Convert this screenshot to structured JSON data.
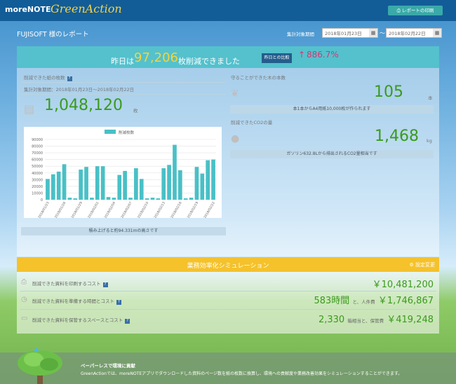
{
  "app": {
    "brand_main": "moreNOTE",
    "brand_sub": "GreenAction",
    "print_button": "レポートの印刷"
  },
  "report": {
    "title": "FUJISOFT 様のレポート",
    "period_label": "集計対象期間",
    "date_from": "2018年01月23日",
    "date_to": "2018年02月22日",
    "date_sep": "～"
  },
  "headline": {
    "prefix": "昨日は",
    "number": "97,206",
    "suffix": "枚削減できました",
    "compare_label": "昨日との比較",
    "arrow": "↑",
    "percent": "886.7%"
  },
  "left": {
    "label": "削減できた紙の枚数",
    "period": "集計対象期間：2018年01月23日～2018年02月22日",
    "total": "1,048,120",
    "unit": "枚",
    "note": "積み上げると約94.331mの高さです"
  },
  "trees": {
    "label": "守ることができた木の本数",
    "value": "105",
    "unit": "本",
    "note": "本1本からA4用紙10,000枚が作られます"
  },
  "co2": {
    "label": "削減できたCO2の量",
    "value": "1,468",
    "unit": "kg",
    "note": "ガソリン632.8Lから排出されるCO2量相当です"
  },
  "chart_data": {
    "type": "bar",
    "legend": "削減枚数",
    "ylim": [
      0,
      90000
    ],
    "yticks": [
      "0",
      "10000",
      "20000",
      "30000",
      "40000",
      "50000",
      "60000",
      "70000",
      "80000",
      "90000"
    ],
    "categories": [
      "2018/01/23",
      "2018/01/24",
      "2018/01/25",
      "2018/01/26",
      "2018/01/27",
      "2018/01/28",
      "2018/01/29",
      "2018/01/30",
      "2018/01/31",
      "2018/02/01",
      "2018/02/02",
      "2018/02/03",
      "2018/02/04",
      "2018/02/05",
      "2018/02/06",
      "2018/02/07",
      "2018/02/08",
      "2018/02/09",
      "2018/02/10",
      "2018/02/11",
      "2018/02/12",
      "2018/02/13",
      "2018/02/14",
      "2018/02/15",
      "2018/02/16",
      "2018/02/17",
      "2018/02/18",
      "2018/02/19",
      "2018/02/20",
      "2018/02/21",
      "2018/02/22"
    ],
    "xtick_labels": [
      "2018/01/23",
      "2018/01/26",
      "2018/01/29",
      "2018/02/01",
      "2018/02/04",
      "2018/02/07",
      "2018/02/10",
      "2018/02/13",
      "2018/02/16",
      "2018/02/19",
      "2018/02/22"
    ],
    "values": [
      31000,
      38000,
      42000,
      53000,
      3000,
      2000,
      45000,
      49000,
      3000,
      50000,
      50000,
      4000,
      3000,
      37000,
      43000,
      3000,
      47000,
      31000,
      2000,
      3000,
      2000,
      47000,
      52000,
      82000,
      44000,
      2000,
      3000,
      49000,
      39000,
      59000,
      60000
    ],
    "color": "#49c0c6"
  },
  "simulation": {
    "title": "業務効率化シミュレーション",
    "settings": "設定変更",
    "rows": [
      {
        "label": "削減できた資料を印刷するコスト",
        "value": "￥10,481,200",
        "mid": "",
        "mid_label": "",
        "cost_label": ""
      },
      {
        "label": "削減できた資料を準備する時間とコスト",
        "value": "583時間",
        "mid": "と、人件費",
        "cost": "￥1,746,867"
      },
      {
        "label": "削減できた資料を保管するスペースとコスト",
        "value": "2,330",
        "mid": "箱相当と、保管費",
        "cost": "￥419,248"
      }
    ]
  },
  "footer": {
    "title": "ペーパーレスで環境に貢献",
    "desc": "GreenActionでは、moreNOTEアプリでダウンロードした資料のページ数を紙の枚数に換算し、環境への貢献度や業務改善効果をシミュレーションすることができます。"
  },
  "icons": [
    "print-icon",
    "calendar-icon",
    "question-icon",
    "document-icon",
    "leaf-icon",
    "bulb-icon",
    "gear-icon",
    "printer-icon",
    "clock-icon",
    "box-icon"
  ]
}
